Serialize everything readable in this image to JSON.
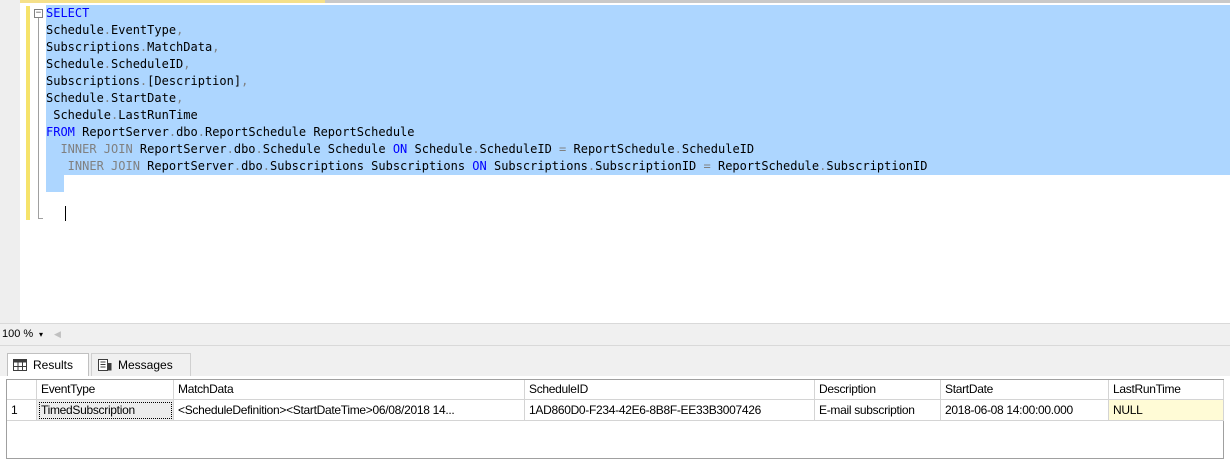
{
  "editor": {
    "lines": [
      [
        {
          "t": "SELECT",
          "c": "kw"
        }
      ],
      [
        {
          "t": "Schedule"
        },
        {
          "t": ".",
          "c": "kg"
        },
        {
          "t": "EventType"
        },
        {
          "t": ",",
          "c": "kg"
        }
      ],
      [
        {
          "t": "Subscriptions"
        },
        {
          "t": ".",
          "c": "kg"
        },
        {
          "t": "MatchData"
        },
        {
          "t": ",",
          "c": "kg"
        }
      ],
      [
        {
          "t": "Schedule"
        },
        {
          "t": ".",
          "c": "kg"
        },
        {
          "t": "ScheduleID"
        },
        {
          "t": ",",
          "c": "kg"
        }
      ],
      [
        {
          "t": "Subscriptions"
        },
        {
          "t": ".",
          "c": "kg"
        },
        {
          "t": "[Description]"
        },
        {
          "t": ",",
          "c": "kg"
        }
      ],
      [
        {
          "t": "Schedule"
        },
        {
          "t": ".",
          "c": "kg"
        },
        {
          "t": "StartDate"
        },
        {
          "t": ",",
          "c": "kg"
        }
      ],
      [
        {
          "t": " Schedule"
        },
        {
          "t": ".",
          "c": "kg"
        },
        {
          "t": "LastRunTime"
        }
      ],
      [
        {
          "t": "FROM",
          "c": "kw"
        },
        {
          "t": " ReportServer"
        },
        {
          "t": ".",
          "c": "kg"
        },
        {
          "t": "dbo"
        },
        {
          "t": ".",
          "c": "kg"
        },
        {
          "t": "ReportSchedule ReportSchedule"
        }
      ],
      [
        {
          "t": "  INNER JOIN",
          "c": "kg"
        },
        {
          "t": " ReportServer"
        },
        {
          "t": ".",
          "c": "kg"
        },
        {
          "t": "dbo"
        },
        {
          "t": ".",
          "c": "kg"
        },
        {
          "t": "Schedule Schedule "
        },
        {
          "t": "ON",
          "c": "kw"
        },
        {
          "t": " Schedule"
        },
        {
          "t": ".",
          "c": "kg"
        },
        {
          "t": "ScheduleID "
        },
        {
          "t": "=",
          "c": "kg"
        },
        {
          "t": " ReportSchedule"
        },
        {
          "t": ".",
          "c": "kg"
        },
        {
          "t": "ScheduleID"
        }
      ],
      [
        {
          "t": "   INNER JOIN",
          "c": "kg"
        },
        {
          "t": " ReportServer"
        },
        {
          "t": ".",
          "c": "kg"
        },
        {
          "t": "dbo"
        },
        {
          "t": ".",
          "c": "kg"
        },
        {
          "t": "Subscriptions Subscriptions "
        },
        {
          "t": "ON",
          "c": "kw"
        },
        {
          "t": " Subscriptions"
        },
        {
          "t": ".",
          "c": "kg"
        },
        {
          "t": "SubscriptionID "
        },
        {
          "t": "=",
          "c": "kg"
        },
        {
          "t": " ReportSchedule"
        },
        {
          "t": ".",
          "c": "kg"
        },
        {
          "t": "SubscriptionID"
        }
      ],
      [
        {
          "t": " "
        }
      ]
    ],
    "fold_symbol": "−"
  },
  "zoom": {
    "value": "100 %",
    "dropdown_glyph": "▾",
    "scroll_glyph": "◀"
  },
  "tabs": {
    "results_label": "Results",
    "messages_label": "Messages"
  },
  "grid": {
    "columns": [
      "EventType",
      "MatchData",
      "ScheduleID",
      "Description",
      "StartDate",
      "LastRunTime"
    ],
    "rows": [
      {
        "row_number": "1",
        "cells": [
          "TimedSubscription",
          "<ScheduleDefinition><StartDateTime>06/08/2018 14...",
          "1AD860D0-F234-42E6-8B8F-EE33B3007426",
          "E-mail subscription",
          "2018-06-08 14:00:00.000",
          "NULL"
        ]
      }
    ]
  },
  "colors": {
    "keyword": "#0000ff",
    "gray_token": "#808080",
    "selection": "#add6ff",
    "change_bar": "#f6e36b"
  }
}
